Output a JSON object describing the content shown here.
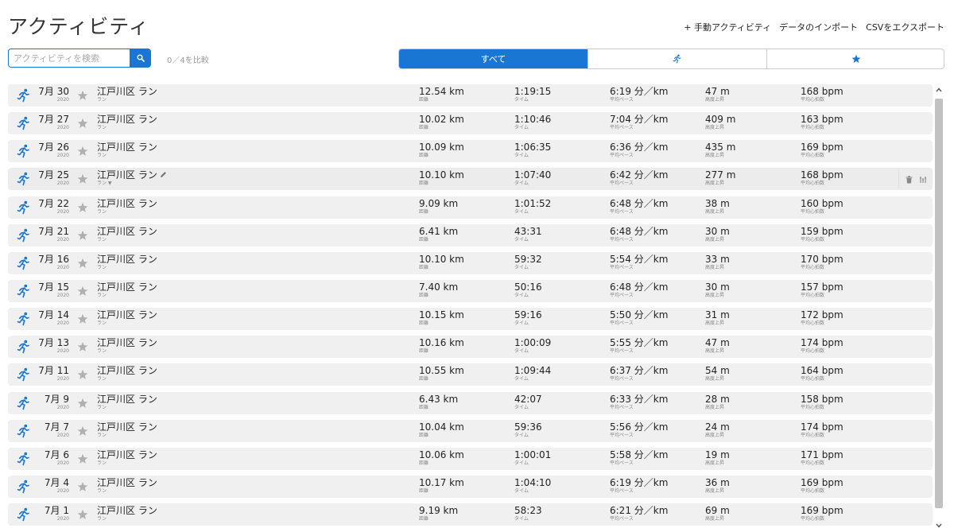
{
  "page": {
    "title": "アクティビティ"
  },
  "top_links": {
    "manual": "+ 手動アクティビティ",
    "import": "データのインポート",
    "export": "CSVをエクスポート"
  },
  "search": {
    "placeholder": "アクティビティを検索",
    "value": "",
    "icon": "search-icon"
  },
  "compare": {
    "text": "0／4を比較"
  },
  "filter_tabs": [
    {
      "label": "すべて",
      "active": true
    },
    {
      "label": "",
      "icon": "running-icon",
      "active": false
    },
    {
      "label": "",
      "icon": "star-icon",
      "active": false
    }
  ],
  "labels": {
    "distance": "距離",
    "time": "タイム",
    "pace": "平均ペース",
    "elevation": "高度上昇",
    "heart_rate": "平均心拍数"
  },
  "colors": {
    "accent": "#1976d2",
    "star": "#b0b0b0",
    "row_bg": "#f0f0f0"
  },
  "activities": [
    {
      "date": "7月 30",
      "year": "2020",
      "name": "江戸川区 ラン",
      "type": "ラン",
      "distance": "12.54 km",
      "time": "1:19:15",
      "pace": "6:19 分／km",
      "elevation": "47 m",
      "heart_rate": "168 bpm"
    },
    {
      "date": "7月 27",
      "year": "2020",
      "name": "江戸川区 ラン",
      "type": "ラン",
      "distance": "10.02 km",
      "time": "1:10:46",
      "pace": "7:04 分／km",
      "elevation": "409 m",
      "heart_rate": "163 bpm"
    },
    {
      "date": "7月 26",
      "year": "2020",
      "name": "江戸川区 ラン",
      "type": "ラン",
      "distance": "10.09 km",
      "time": "1:06:35",
      "pace": "6:36 分／km",
      "elevation": "435 m",
      "heart_rate": "169 bpm"
    },
    {
      "date": "7月 25",
      "year": "2020",
      "name": "江戸川区 ラン",
      "type": "ラン ▼",
      "distance": "10.10 km",
      "time": "1:07:40",
      "pace": "6:42 分／km",
      "elevation": "277 m",
      "heart_rate": "168 bpm",
      "hover": true
    },
    {
      "date": "7月 22",
      "year": "2020",
      "name": "江戸川区 ラン",
      "type": "ラン",
      "distance": "9.09 km",
      "time": "1:01:52",
      "pace": "6:48 分／km",
      "elevation": "38 m",
      "heart_rate": "160 bpm"
    },
    {
      "date": "7月 21",
      "year": "2020",
      "name": "江戸川区 ラン",
      "type": "ラン",
      "distance": "6.41 km",
      "time": "43:31",
      "pace": "6:48 分／km",
      "elevation": "30 m",
      "heart_rate": "159 bpm"
    },
    {
      "date": "7月 16",
      "year": "2020",
      "name": "江戸川区 ラン",
      "type": "ラン",
      "distance": "10.10 km",
      "time": "59:32",
      "pace": "5:54 分／km",
      "elevation": "33 m",
      "heart_rate": "170 bpm"
    },
    {
      "date": "7月 15",
      "year": "2020",
      "name": "江戸川区 ラン",
      "type": "ラン",
      "distance": "7.40 km",
      "time": "50:16",
      "pace": "6:48 分／km",
      "elevation": "30 m",
      "heart_rate": "157 bpm"
    },
    {
      "date": "7月 14",
      "year": "2020",
      "name": "江戸川区 ラン",
      "type": "ラン",
      "distance": "10.15 km",
      "time": "59:16",
      "pace": "5:50 分／km",
      "elevation": "31 m",
      "heart_rate": "172 bpm"
    },
    {
      "date": "7月 13",
      "year": "2020",
      "name": "江戸川区 ラン",
      "type": "ラン",
      "distance": "10.16 km",
      "time": "1:00:09",
      "pace": "5:55 分／km",
      "elevation": "47 m",
      "heart_rate": "174 bpm"
    },
    {
      "date": "7月 11",
      "year": "2020",
      "name": "江戸川区 ラン",
      "type": "ラン",
      "distance": "10.55 km",
      "time": "1:09:44",
      "pace": "6:37 分／km",
      "elevation": "54 m",
      "heart_rate": "164 bpm"
    },
    {
      "date": "7月 9",
      "year": "2020",
      "name": "江戸川区 ラン",
      "type": "ラン",
      "distance": "6.43 km",
      "time": "42:07",
      "pace": "6:33 分／km",
      "elevation": "28 m",
      "heart_rate": "158 bpm"
    },
    {
      "date": "7月 7",
      "year": "2020",
      "name": "江戸川区 ラン",
      "type": "ラン",
      "distance": "10.04 km",
      "time": "59:36",
      "pace": "5:56 分／km",
      "elevation": "24 m",
      "heart_rate": "174 bpm"
    },
    {
      "date": "7月 6",
      "year": "2020",
      "name": "江戸川区 ラン",
      "type": "ラン",
      "distance": "10.06 km",
      "time": "1:00:01",
      "pace": "5:58 分／km",
      "elevation": "19 m",
      "heart_rate": "171 bpm"
    },
    {
      "date": "7月 4",
      "year": "2020",
      "name": "江戸川区 ラン",
      "type": "ラン",
      "distance": "10.17 km",
      "time": "1:04:10",
      "pace": "6:19 分／km",
      "elevation": "36 m",
      "heart_rate": "169 bpm"
    },
    {
      "date": "7月 1",
      "year": "2020",
      "name": "江戸川区 ラン",
      "type": "ラン",
      "distance": "9.19 km",
      "time": "58:23",
      "pace": "6:21 分／km",
      "elevation": "69 m",
      "heart_rate": "169 bpm"
    }
  ]
}
